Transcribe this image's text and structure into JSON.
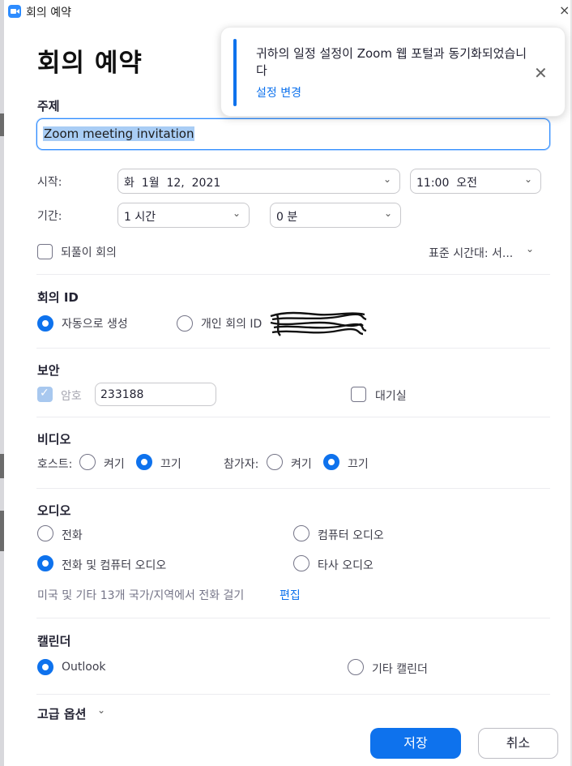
{
  "window": {
    "title": "회의 예약"
  },
  "page": {
    "title": "회의 예약"
  },
  "notification": {
    "message": "귀하의 일정 설정이 Zoom 웹 포털과 동기화되었습니다",
    "link": "설정 변경"
  },
  "topic": {
    "label": "주제",
    "value": "Zoom meeting invitation"
  },
  "schedule": {
    "start_label": "시작:",
    "start_date": "화  1월  12,  2021",
    "start_time": "11:00  오전",
    "duration_label": "기간:",
    "duration_hours": "1 시간",
    "duration_minutes": "0 분",
    "recurring_label": "되풀이 회의",
    "timezone": "표준 시간대: 서..."
  },
  "meeting_id": {
    "title": "회의 ID",
    "auto_label": "자동으로 생성",
    "personal_label": "개인 회의 ID",
    "selected": "auto"
  },
  "security": {
    "title": "보안",
    "password_label": "암호",
    "password_value": "233188",
    "waiting_room_label": "대기실"
  },
  "video": {
    "title": "비디오",
    "host_label": "호스트:",
    "participant_label": "참가자:",
    "on_label": "켜기",
    "off_label": "끄기",
    "host_selected": "off",
    "participant_selected": "off"
  },
  "audio": {
    "title": "오디오",
    "phone_label": "전화",
    "computer_label": "컴퓨터 오디오",
    "both_label": "전화 및 컴퓨터 오디오",
    "third_party_label": "타사 오디오",
    "selected": "both",
    "dialin_note": "미국 및 기타 13개 국가/지역에서 전화 걸기",
    "edit_link": "편집"
  },
  "calendar": {
    "title": "캘린더",
    "outlook_label": "Outlook",
    "other_label": "기타 캘린더",
    "selected": "outlook"
  },
  "advanced": {
    "label": "고급 옵션"
  },
  "buttons": {
    "save": "저장",
    "cancel": "취소"
  },
  "colors": {
    "accent": "#0e72ed",
    "text": "#232333",
    "highlight": "#a9cdf5"
  }
}
